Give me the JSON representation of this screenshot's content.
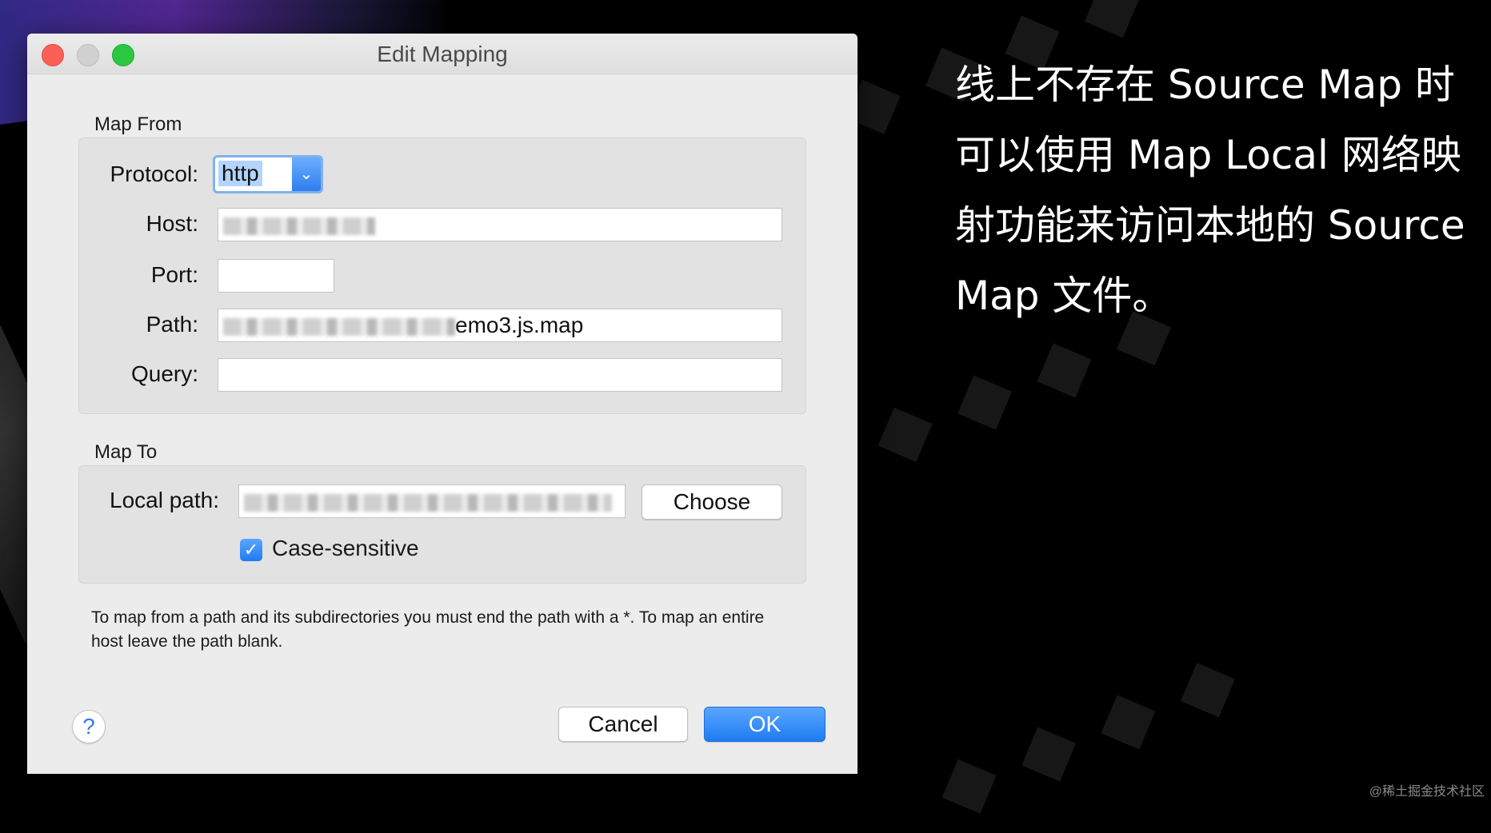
{
  "window": {
    "title": "Edit Mapping"
  },
  "map_from": {
    "label": "Map From",
    "protocol": {
      "label": "Protocol:",
      "value": "http"
    },
    "host": {
      "label": "Host:",
      "value": ""
    },
    "port": {
      "label": "Port:",
      "value": ""
    },
    "path": {
      "label": "Path:",
      "value": "emo3.js.map"
    },
    "query": {
      "label": "Query:",
      "value": ""
    }
  },
  "map_to": {
    "label": "Map To",
    "local_path": {
      "label": "Local path:",
      "value": ""
    },
    "choose_label": "Choose",
    "case_sensitive": {
      "label": "Case-sensitive",
      "checked": true
    }
  },
  "hint": "To map from a path and its subdirectories you must end the path with a *. To map an entire host leave the path blank.",
  "buttons": {
    "help": "?",
    "cancel": "Cancel",
    "ok": "OK"
  },
  "side_text": "线上不存在 Source Map 时可以使用 Map Local 网络映射功能来访问本地的 Source Map 文件。",
  "credit": "@稀土掘金技术社区",
  "colors": {
    "accent": "#1f7bf2",
    "close": "#fc5f57",
    "maximize": "#2ac840"
  }
}
